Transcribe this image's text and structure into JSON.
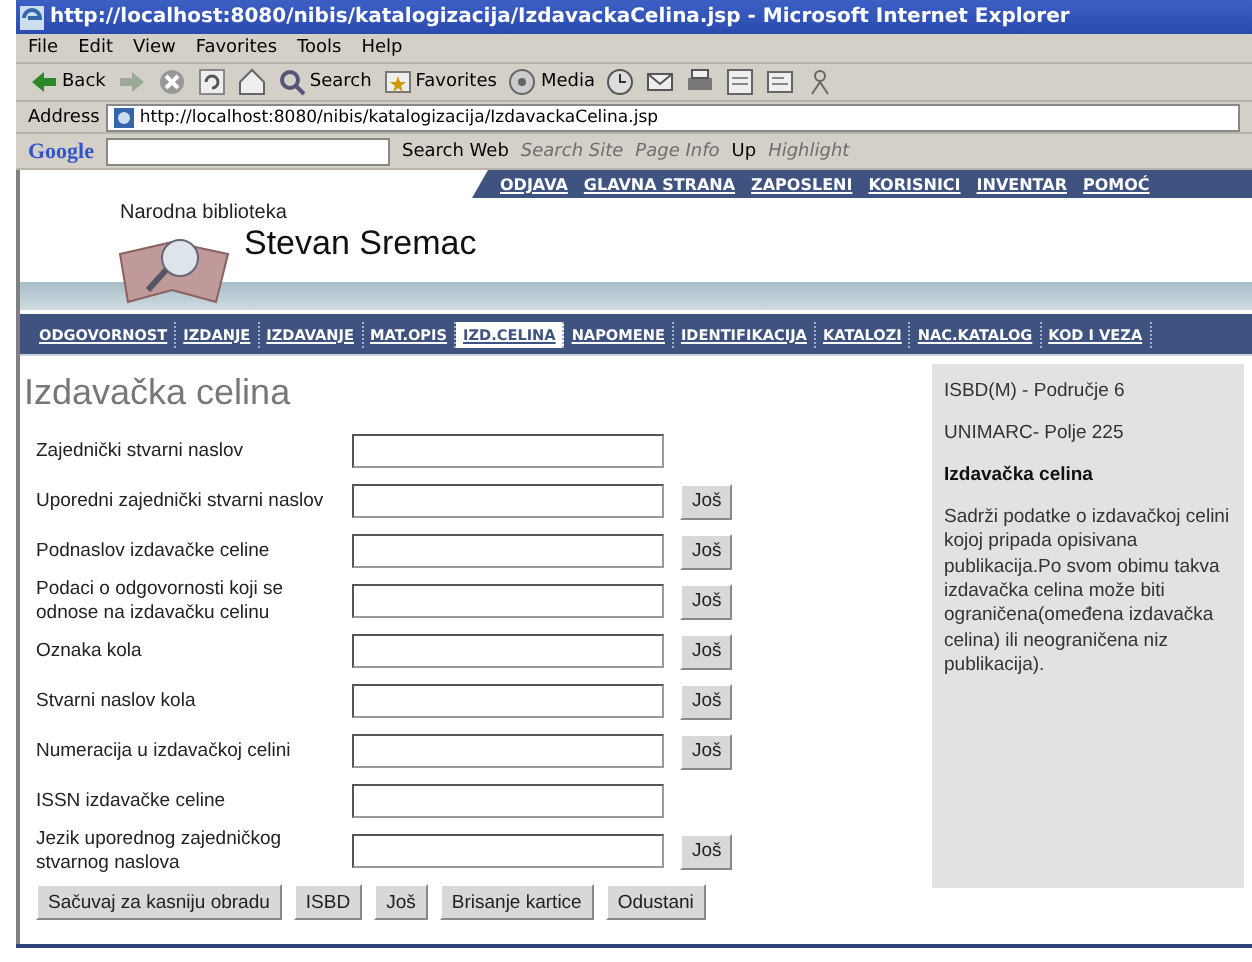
{
  "window": {
    "title": "http://localhost:8080/nibis/katalogizacija/IzdavackaCelina.jsp - Microsoft Internet Explorer"
  },
  "menu": [
    "File",
    "Edit",
    "View",
    "Favorites",
    "Tools",
    "Help"
  ],
  "toolbar": [
    {
      "kind": "back",
      "label": "Back"
    },
    {
      "kind": "forward"
    },
    {
      "kind": "stop"
    },
    {
      "kind": "refresh"
    },
    {
      "kind": "home"
    },
    {
      "kind": "search",
      "label": "Search"
    },
    {
      "kind": "favorites",
      "label": "Favorites"
    },
    {
      "kind": "media",
      "label": "Media"
    },
    {
      "kind": "history"
    },
    {
      "kind": "mail"
    },
    {
      "kind": "print"
    },
    {
      "kind": "edit"
    },
    {
      "kind": "discuss"
    },
    {
      "kind": "messenger"
    }
  ],
  "address": {
    "label": "Address",
    "url": "http://localhost:8080/nibis/katalogizacija/IzdavackaCelina.jsp"
  },
  "google_toolbar": {
    "logo": "Google",
    "items": [
      {
        "label": "Search Web",
        "disabled": false
      },
      {
        "label": "Search Site",
        "disabled": true
      },
      {
        "label": "Page Info",
        "disabled": true
      },
      {
        "label": "Up",
        "disabled": false
      },
      {
        "label": "Highlight",
        "disabled": true
      }
    ]
  },
  "top_links": [
    "ODJAVA",
    "GLAVNA STRANA",
    "ZAPOSLENI",
    "KORISNICI",
    "INVENTAR",
    "POMOĆ"
  ],
  "logo": {
    "subtitle": "Narodna biblioteka",
    "title": "Stevan Sremac"
  },
  "tabs": [
    {
      "label": "ODGOVORNOST",
      "selected": false
    },
    {
      "label": "IZDANJE",
      "selected": false
    },
    {
      "label": "IZDAVANJE",
      "selected": false
    },
    {
      "label": "MAT.OPIS",
      "selected": false
    },
    {
      "label": "IZD.CELINA",
      "selected": true
    },
    {
      "label": "NAPOMENE",
      "selected": false
    },
    {
      "label": "IDENTIFIKACIJA",
      "selected": false
    },
    {
      "label": "KATALOZI",
      "selected": false
    },
    {
      "label": "NAC.KATALOG",
      "selected": false
    },
    {
      "label": "KOD I VEZA",
      "selected": false
    }
  ],
  "heading": "Izdavačka celina",
  "fields": [
    {
      "label": "Zajednički stvarni naslov"
    },
    {
      "label": "Uporedni zajednički stvarni naslov",
      "more": "Još"
    },
    {
      "label": "Podnaslov izdavačke celine",
      "more": "Još"
    },
    {
      "label": "Podaci o odgovornosti koji se odnose na izdavačku celinu",
      "more": "Još"
    },
    {
      "label": "Oznaka kola",
      "more": "Još"
    },
    {
      "label": "Stvarni naslov kola",
      "more": "Još"
    },
    {
      "label": "Numeracija u izdavačkoj celini",
      "more": "Još"
    },
    {
      "label": "ISSN izdavačke celine"
    },
    {
      "label": "Jezik uporednog zajedničkog stvarnog naslova",
      "more": "Još"
    }
  ],
  "buttons": [
    "Sačuvaj za kasniju obradu",
    "ISBD",
    "Još",
    "Brisanje kartice",
    "Odustani"
  ],
  "side_panel": {
    "lines": [
      "ISBD(M) - Područje 6",
      "UNIMARC- Polje 225"
    ],
    "title": "Izdavačka celina",
    "text": "Sadrži podatke o izdavačkoj celini kojoj pripada opisivana publikacija.Po svom obimu takva izdavačka celina može biti ograničena(omeđena izdavačka celina) ili neograničena niz publikacija)."
  }
}
